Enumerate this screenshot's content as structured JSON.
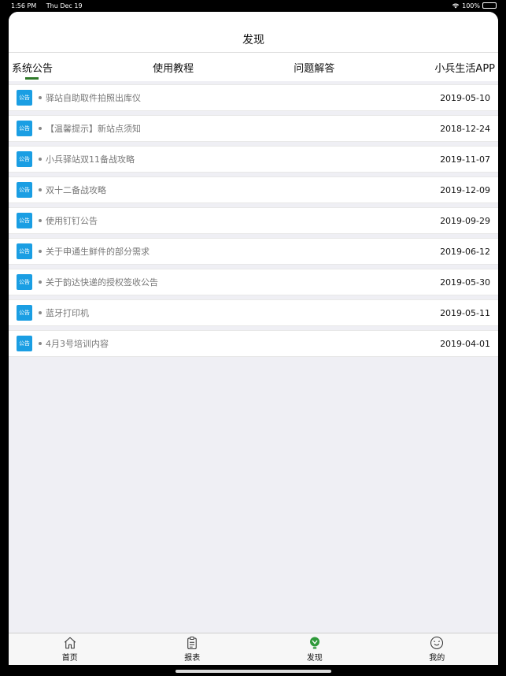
{
  "status_bar": {
    "time": "1:56 PM",
    "date": "Thu Dec 19",
    "battery": "100%"
  },
  "nav": {
    "title": "发现"
  },
  "tabs": [
    {
      "label": "系统公告",
      "active": true
    },
    {
      "label": "使用教程",
      "active": false
    },
    {
      "label": "问题解答",
      "active": false
    },
    {
      "label": "小兵生活APP",
      "active": false
    }
  ],
  "list": {
    "badge_label": "公告",
    "items": [
      {
        "title": "驿站自助取件拍照出库仪",
        "date": "2019-05-10"
      },
      {
        "title": "【温馨提示】新站点须知",
        "date": "2018-12-24"
      },
      {
        "title": "小兵驿站双11备战攻略",
        "date": "2019-11-07"
      },
      {
        "title": "双十二备战攻略",
        "date": "2019-12-09"
      },
      {
        "title": "使用钉钉公告",
        "date": "2019-09-29"
      },
      {
        "title": "关于申通生鲜件的部分需求",
        "date": "2019-06-12"
      },
      {
        "title": "关于韵达快递的授权签收公告",
        "date": "2019-05-30"
      },
      {
        "title": "蓝牙打印机",
        "date": "2019-05-11"
      },
      {
        "title": "4月3号培训内容",
        "date": "2019-04-01"
      }
    ]
  },
  "tabbar": [
    {
      "label": "首页",
      "icon": "home-icon"
    },
    {
      "label": "报表",
      "icon": "clipboard-icon"
    },
    {
      "label": "发现",
      "icon": "discover-icon",
      "active": true
    },
    {
      "label": "我的",
      "icon": "smiley-icon"
    }
  ],
  "colors": {
    "accent": "#2f7a2a",
    "badge": "#1a9ee3",
    "background": "#efeff4"
  }
}
